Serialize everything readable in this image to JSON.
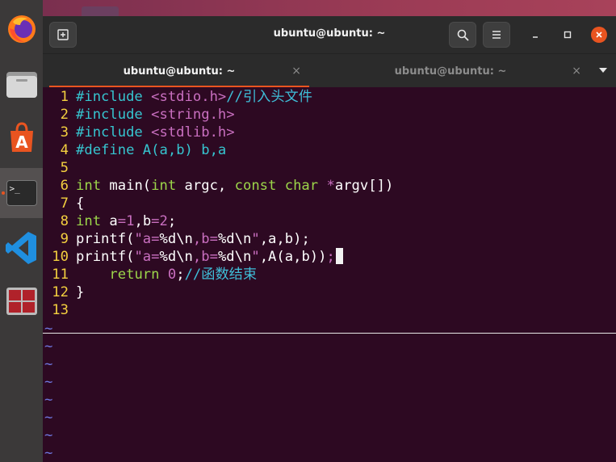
{
  "dock": {
    "apps": [
      {
        "name": "Firefox",
        "icon": "firefox-icon"
      },
      {
        "name": "Files",
        "icon": "files-icon"
      },
      {
        "name": "Ubuntu Software",
        "icon": "software-icon"
      },
      {
        "name": "Terminal",
        "icon": "terminal-icon",
        "prompt": ">_"
      },
      {
        "name": "Visual Studio Code",
        "icon": "vscode-icon"
      },
      {
        "name": "Remote Desktop",
        "icon": "remote-icon"
      }
    ]
  },
  "window": {
    "title": "ubuntu@ubuntu: ~",
    "tabs": [
      {
        "label": "ubuntu@ubuntu: ~",
        "active": true,
        "close": "×"
      },
      {
        "label": "ubuntu@ubuntu: ~",
        "active": false,
        "close": "×"
      }
    ]
  },
  "editor": {
    "line_numbers": [
      "1",
      "2",
      "3",
      "4",
      "5",
      "6",
      "7",
      "8",
      "9",
      "10",
      "11",
      "12",
      "13"
    ],
    "l1": {
      "directive": "#include ",
      "header": "<stdio.h>",
      "comment": "//引入头文件"
    },
    "l2": {
      "directive": "#include ",
      "header": "<string.h>"
    },
    "l3": {
      "directive": "#include ",
      "header": "<stdlib.h>"
    },
    "l4": {
      "directive": "#define ",
      "macro": "A(a,b) b,a"
    },
    "l6": {
      "kw1": "int",
      "t1": " main(",
      "kw2": "int",
      "t2": " argc, ",
      "kw3": "const",
      "t3": " ",
      "kw4": "char",
      "t4": " ",
      "star": "*",
      "t5": "argv[])"
    },
    "l7": {
      "text": "{"
    },
    "l8": {
      "kw": "int",
      "t1": " a",
      "eq1": "=",
      "n1": "1",
      "t2": ",b",
      "eq2": "=",
      "n2": "2",
      "t3": ";"
    },
    "l9": {
      "fn": "printf(",
      "s1": "\"a=",
      "f1": "%d",
      "e1": "\\n",
      "s2": ",b=",
      "f2": "%d",
      "e2": "\\n",
      "s3": "\"",
      "t": ",a,b);"
    },
    "l10": {
      "fn": "printf(",
      "s1": "\"a=",
      "f1": "%d",
      "e1": "\\n",
      "s2": ",b=",
      "f2": "%d",
      "e2": "\\n",
      "s3": "\"",
      "t1": ",A(a,b))",
      "semi": ";"
    },
    "l11": {
      "indent": "    ",
      "kw": "return",
      "sp": " ",
      "n": "0",
      "semi": ";",
      "comment": "//函数结束"
    },
    "l12": {
      "text": "}"
    },
    "tilde": "~"
  },
  "colors": {
    "background": "#2d0922",
    "line_number": "#f4d03f",
    "preprocessor": "#36c5d0",
    "string": "#c96fc0",
    "keyword": "#9cd64a",
    "accent": "#e95420"
  }
}
